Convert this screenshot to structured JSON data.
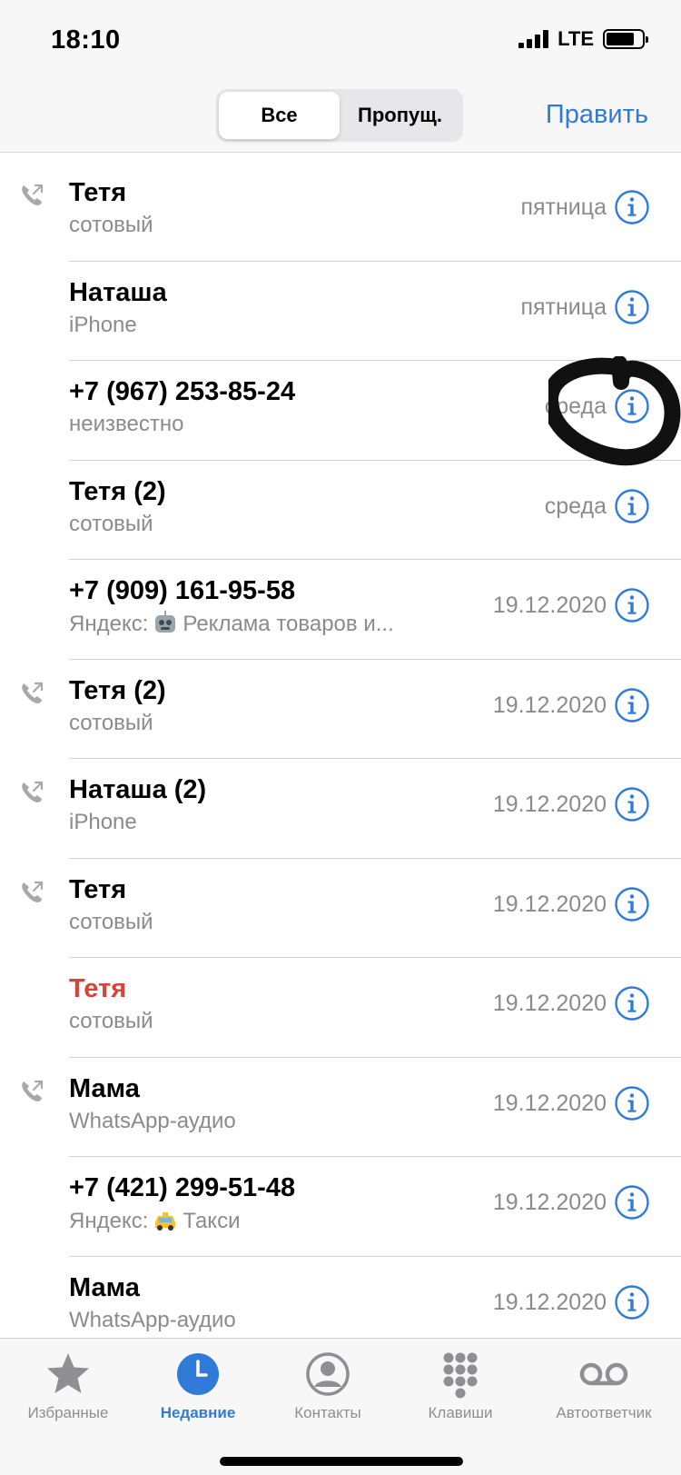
{
  "status_bar": {
    "time": "18:10",
    "network": "LTE"
  },
  "header": {
    "segments": [
      "Все",
      "Пропущ."
    ],
    "active_segment": "Все",
    "edit_label": "Править"
  },
  "colors": {
    "accent": "#2f7bd7",
    "missed": "#d4443a",
    "secondary": "#8b8b8f"
  },
  "calls": [
    {
      "name": "Тетя",
      "type": "сотовый",
      "date": "пятница",
      "outgoing": true,
      "missed": false
    },
    {
      "name": "Наташа",
      "type": "iPhone",
      "date": "пятница",
      "outgoing": false,
      "missed": false
    },
    {
      "name": "+7 (967) 253-85-24",
      "type": "неизвестно",
      "date": "среда",
      "outgoing": false,
      "missed": false
    },
    {
      "name": "Тетя (2)",
      "type": "сотовый",
      "date": "среда",
      "outgoing": false,
      "missed": false
    },
    {
      "name": "+7 (909) 161-95-58",
      "type_prefix": "Яндекс:",
      "type_icon": "robot-emoji",
      "type_suffix": "Реклама товаров и...",
      "date": "19.12.2020",
      "outgoing": false,
      "missed": false
    },
    {
      "name": "Тетя (2)",
      "type": "сотовый",
      "date": "19.12.2020",
      "outgoing": true,
      "missed": false
    },
    {
      "name": "Наташа (2)",
      "type": "iPhone",
      "date": "19.12.2020",
      "outgoing": true,
      "missed": false
    },
    {
      "name": "Тетя",
      "type": "сотовый",
      "date": "19.12.2020",
      "outgoing": true,
      "missed": false
    },
    {
      "name": "Тетя",
      "type": "сотовый",
      "date": "19.12.2020",
      "outgoing": false,
      "missed": true
    },
    {
      "name": "Мама",
      "type": "WhatsApp-аудио",
      "date": "19.12.2020",
      "outgoing": true,
      "missed": false
    },
    {
      "name": "+7 (421) 299-51-48",
      "type_prefix": "Яндекс:",
      "type_icon": "taxi-emoji",
      "type_suffix": "Такси",
      "date": "19.12.2020",
      "outgoing": false,
      "missed": false
    },
    {
      "name": "Мама",
      "type": "WhatsApp-аудио",
      "date": "19.12.2020",
      "outgoing": false,
      "missed": false
    }
  ],
  "tabs": [
    {
      "label": "Избранные",
      "icon": "star-icon",
      "active": false
    },
    {
      "label": "Недавние",
      "icon": "clock-icon",
      "active": true
    },
    {
      "label": "Контакты",
      "icon": "contact-icon",
      "active": false
    },
    {
      "label": "Клавиши",
      "icon": "keypad-icon",
      "active": false
    },
    {
      "label": "Автоответчик",
      "icon": "voicemail-icon",
      "active": false
    }
  ]
}
